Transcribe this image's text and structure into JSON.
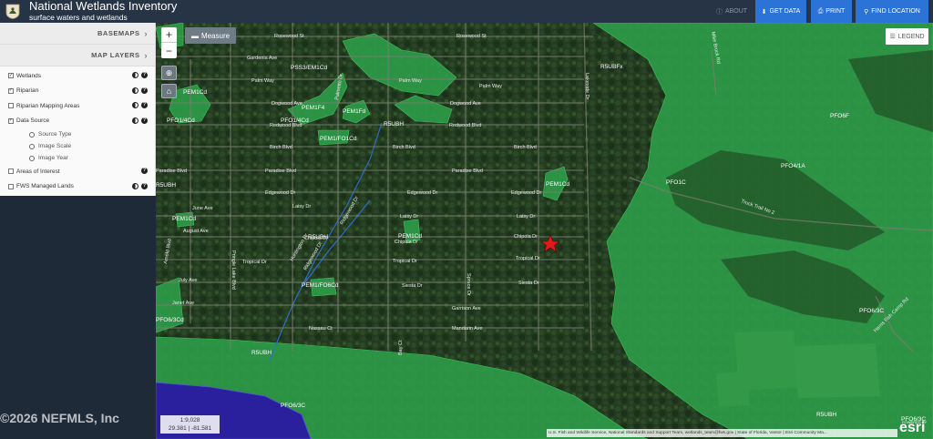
{
  "header": {
    "title": "National Wetlands Inventory",
    "subtitle": "surface waters and wetlands",
    "about_label": "ABOUT",
    "get_data_label": "GET DATA",
    "print_label": "PRINT",
    "find_location_label": "FIND LOCATION"
  },
  "sidebar": {
    "basemaps_label": "BASEMAPS",
    "map_layers_label": "MAP LAYERS",
    "layers": [
      {
        "label": "Wetlands",
        "checked": true
      },
      {
        "label": "Riparian",
        "checked": true
      },
      {
        "label": "Riparian Mapping Areas",
        "checked": false
      },
      {
        "label": "Data Source",
        "checked": true
      },
      {
        "label": "Areas of Interest",
        "checked": false
      },
      {
        "label": "FWS Managed Lands",
        "checked": false
      }
    ],
    "data_source_options": [
      "Source Type",
      "Image Scale",
      "Image Year"
    ]
  },
  "map": {
    "measure_label": "Measure",
    "legend_label": "LEGEND",
    "scale": "1:9,028",
    "coordinates": "29.381 | -81.581",
    "attribution": "U.S. Fish and Wildlife Service, National Standards and Support Team, wetlands_team@fws.gov | State of Florida, Vantor | Esri Community Ma...",
    "esri_powered_by": "POWERED BY",
    "esri_label": "esri",
    "watermark": "©2026 NEFMLS, Inc",
    "streets": [
      "Rosewood St",
      "Gardenia Ave",
      "Palm Way",
      "Dogwood Ave",
      "Redwood Blvd",
      "Birch Blvd",
      "Paradise Blvd",
      "Edgewood Dr",
      "Laisy Dr",
      "Chipola Dr",
      "Tropical Dr",
      "Siesta Dr",
      "Garrison Ave",
      "Mandarin Ave",
      "Nassau Ct",
      "August Ave",
      "June Ave",
      "July Ave",
      "Janet Ave",
      "Ridgewood Dr",
      "Huntington Dr",
      "Truck Trail No 2",
      "Harris Fish Camp Rd",
      "Bay Ct",
      "Spruce Dr",
      "Palmetto Dr",
      "Lakeside Dr",
      "Arnold Blvd",
      "Pringle Lake Blvd",
      "Mike Brock Rd"
    ],
    "wetland_labels": [
      "PSS3/EM1Cd",
      "PEM1Cd",
      "PFO1/4Cd",
      "PEM1F4",
      "PEM1Fd",
      "PFO1/4Cd",
      "PEM1/FO1Cd",
      "R5UBH",
      "PFO6F",
      "PFO4/1A",
      "PFO1C",
      "PEM1Cd",
      "PEM1Cd",
      "PEM1Cd",
      "PEM1/FO6Cd",
      "PFO6/3Cd",
      "R5UBH",
      "PFO6/3C",
      "PFO6/3C",
      "PFO6/3C",
      "R5UBH",
      "R5UBFx",
      "R5UBH",
      "R5UBH"
    ]
  }
}
